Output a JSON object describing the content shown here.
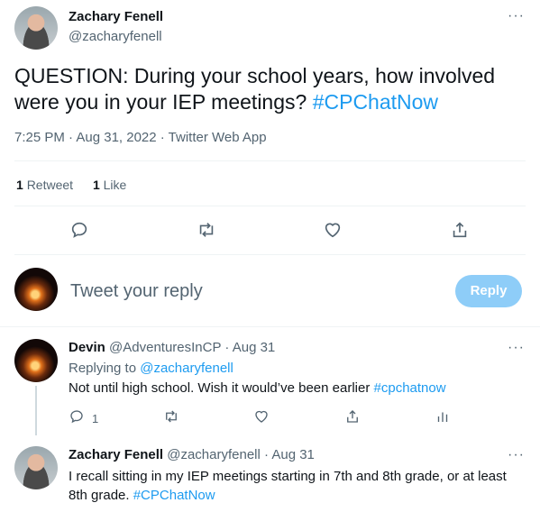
{
  "main_tweet": {
    "author_name": "Zachary Fenell",
    "author_handle": "@zacharyfenell",
    "text": "QUESTION: During your school years, how involved were you in your IEP meetings? ",
    "hashtag": "#CPChatNow",
    "timestamp": "7:25 PM · Aug 31, 2022 · Twitter Web App",
    "retweet_count": "1",
    "retweet_label": "Retweet",
    "like_count": "1",
    "like_label": "Like"
  },
  "composer": {
    "placeholder": "Tweet your reply",
    "button_label": "Reply"
  },
  "replies": [
    {
      "author_name": "Devin",
      "author_handle": "@AdventuresInCP",
      "dot": "·",
      "date": "Aug 31",
      "replying_prefix": "Replying to ",
      "replying_to": "@zacharyfenell",
      "text": "Not until high school. Wish it would’ve been earlier ",
      "hashtag": "#cpchatnow",
      "reply_count": "1"
    },
    {
      "author_name": "Zachary Fenell",
      "author_handle": "@zacharyfenell",
      "dot": "·",
      "date": "Aug 31",
      "text_line1": "I recall sitting in my IEP meetings starting in 7th and 8th grade, or at least",
      "text_line2": "8th grade. ",
      "hashtag": "#CPChatNow"
    }
  ],
  "icons": {
    "more": "more-icon",
    "reply": "reply-icon",
    "retweet": "retweet-icon",
    "like": "like-icon",
    "share": "share-icon",
    "analytics": "analytics-icon"
  },
  "colors": {
    "accent": "#1d9bf0",
    "reply_button": "#8ecdf8",
    "muted": "#536471"
  },
  "more_glyph": "···"
}
